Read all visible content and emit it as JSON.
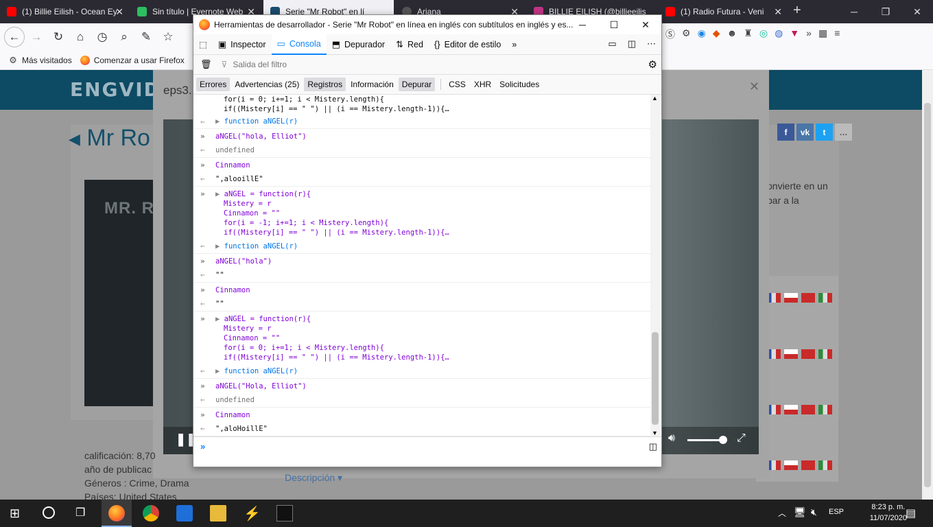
{
  "browser": {
    "tabs": [
      {
        "title": "(1) Billie Eilish - Ocean Ey",
        "favicon": "youtube-icon",
        "color": "#ff0000"
      },
      {
        "title": "Sin título | Evernote Web",
        "favicon": "evernote-icon",
        "color": "#2dbe60"
      },
      {
        "title": "Serie \"Mr Robot\" en lí",
        "favicon": "engvideo-icon",
        "color": "#1a4d6e",
        "active": true
      },
      {
        "title": "Ariana",
        "favicon": "app-icon",
        "color": "#555"
      },
      {
        "title": "BILLIE EILISH (@billieeilis",
        "favicon": "instagram-icon",
        "color": "#c13584"
      },
      {
        "title": "(1) Radio Futura - Veni",
        "favicon": "youtube-icon",
        "color": "#ff0000"
      }
    ],
    "bookmarks": [
      {
        "label": "Más visitados",
        "icon": "gear-icon"
      },
      {
        "label": "Comenzar a usar Firefox",
        "icon": "firefox-icon"
      }
    ]
  },
  "page": {
    "logo": "ENGVIDE",
    "title": "Mr Ro",
    "poster_text": "MR. R",
    "modal_title": "eps3.",
    "right_text": [
      "onvierte en un",
      "bar a la"
    ],
    "info": [
      "calificación: 8,70",
      "año de publicac",
      "Géneros : Crime, Drama",
      "Países: United States"
    ],
    "description_link": "Descripción ▾"
  },
  "devtools": {
    "window_title": "Herramientas de desarrollador - Serie \"Mr Robot\" en línea en inglés con subtítulos en inglés y es...",
    "tabs": [
      {
        "label": "Inspector",
        "icon": "inspector-icon"
      },
      {
        "label": "Consola",
        "icon": "console-icon",
        "selected": true
      },
      {
        "label": "Depurador",
        "icon": "debugger-icon"
      },
      {
        "label": "Red",
        "icon": "network-icon"
      },
      {
        "label": "Editor de estilo",
        "icon": "style-editor-icon"
      }
    ],
    "filter_placeholder": "Salida del filtro",
    "levels": [
      {
        "label": "Errores",
        "on": true
      },
      {
        "label": "Advertencias (25)",
        "on": false
      },
      {
        "label": "Registros",
        "on": true
      },
      {
        "label": "Información",
        "on": false
      },
      {
        "label": "Depurar",
        "on": true
      }
    ],
    "extra_filters": [
      "CSS",
      "XHR",
      "Solicitudes"
    ],
    "console": {
      "fragment_lines": [
        "for(i = 0; i+=1; i < Mistery.length){",
        "if((Mistery[i] == \" \") || (i == Mistery.length-1)){…"
      ],
      "result_fn": "function aNGEL(r)",
      "call1": "aNGEL(\"hola, Elliot\")",
      "undefined": "undefined",
      "cinnamon": "Cinnamon",
      "res1": "\",alooillE\"",
      "def2": [
        "aNGEL = function(r){",
        "Mistery = r",
        "Cinnamon = \"\"",
        "for(i = -1; i+=1; i < Mistery.length){",
        "if((Mistery[i] == \" \") || (i == Mistery.length-1)){…"
      ],
      "call2": "aNGEL(\"hola\")",
      "empty": "\"\"",
      "def3": [
        "aNGEL = function(r){",
        "Mistery = r",
        "Cinnamon = \"\"",
        "for(i = 0; i+=1; i < Mistery.length){",
        "if((Mistery[i] == \" \") || (i == Mistery.length-1)){…"
      ],
      "call3": "aNGEL(\"Hola, Elliot\")",
      "res3": "\",aloHoillE\""
    }
  },
  "taskbar": {
    "language": "ESP",
    "time": "8:23 p. m.",
    "date": "11/07/2020"
  }
}
